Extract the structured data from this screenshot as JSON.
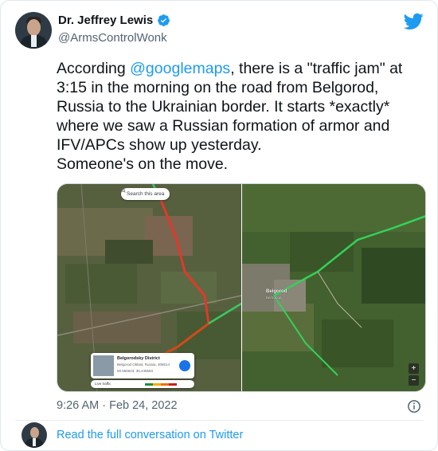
{
  "author": {
    "display_name": "Dr. Jeffrey Lewis",
    "handle": "@ArmsControlWonk",
    "verified": true
  },
  "tweet": {
    "lines": [
      [
        "According ",
        "@googlemaps",
        ", there is a \"traffic jam\" at"
      ],
      "3:15 in the morning on the road from Belgorod,",
      "Russia to the Ukrainian border.  It starts *exactly*",
      "where we saw a Russian formation of armor and",
      "IFV/APCs show up yesterday.",
      "Someone's on the move."
    ],
    "line1_prefix": "According ",
    "line1_mention": "@googlemaps",
    "line1_suffix": ", there is a \"traffic jam\" at"
  },
  "media": {
    "left_map": {
      "search_chip": "Search this area",
      "info_card": {
        "title": "Belgorodsky District",
        "subtitle": "Belgorod Oblast, Russia, 308514",
        "coords": "50.556623, 36.445583"
      },
      "traffic_label": "Live traffic"
    },
    "right_map": {
      "city_label": "Belgorod",
      "city_label_ru": "Белгород",
      "zoom_in": "+",
      "zoom_out": "−"
    }
  },
  "timestamp": "9:26 AM · Feb 24, 2022",
  "read_more": "Read the full conversation on Twitter",
  "colors": {
    "link": "#1d9bf0",
    "verified": "#1d9bf0",
    "twitter_bird": "#1d9bf0",
    "traffic_red": "#c5221f",
    "traffic_green": "#1e8e3e",
    "road_green": "#34c759"
  },
  "icons": [
    "verified-badge-icon",
    "twitter-bird-icon",
    "info-icon",
    "search-icon",
    "directions-icon"
  ]
}
